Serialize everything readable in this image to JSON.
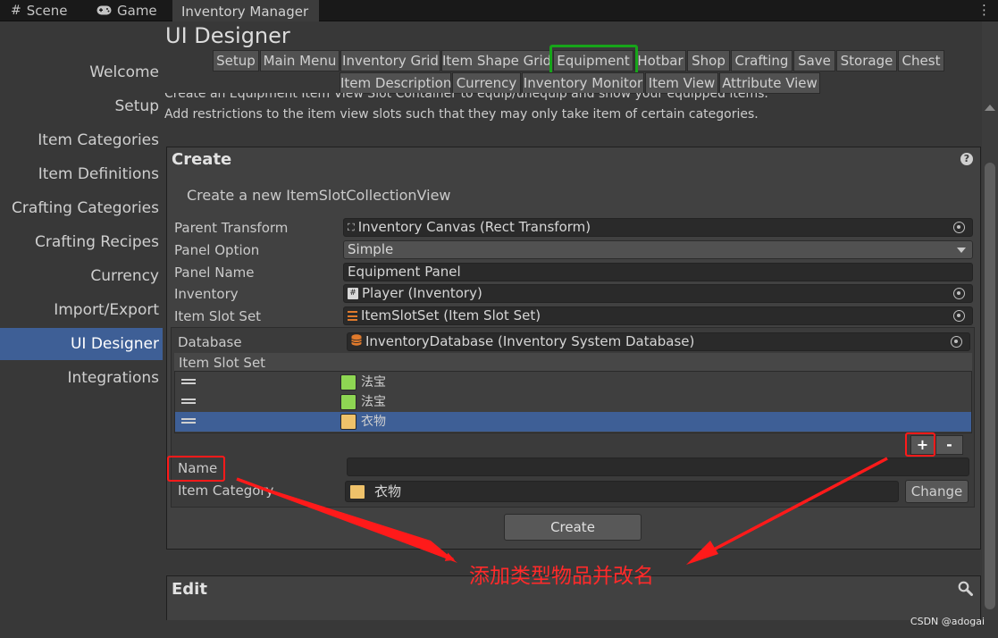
{
  "tabs": [
    {
      "label": "Scene",
      "icon": "hash-icon"
    },
    {
      "label": "Game",
      "icon": "gamepad-icon"
    },
    {
      "label": "Inventory Manager",
      "icon": ""
    }
  ],
  "sidebar": {
    "items": [
      {
        "label": "Welcome"
      },
      {
        "label": "Setup"
      },
      {
        "label": "Item Categories"
      },
      {
        "label": "Item Definitions"
      },
      {
        "label": "Crafting Categories"
      },
      {
        "label": "Crafting Recipes"
      },
      {
        "label": "Currency"
      },
      {
        "label": "Import/Export"
      },
      {
        "label": "UI Designer"
      },
      {
        "label": "Integrations"
      }
    ],
    "active": "UI Designer"
  },
  "header": {
    "title": "UI Designer",
    "nav_row1": [
      "Setup",
      "Main Menu",
      "Inventory Grid",
      "Item Shape Grid",
      "Equipment",
      "Hotbar",
      "Shop",
      "Crafting",
      "Save",
      "Storage",
      "Chest"
    ],
    "nav_row2": [
      "Item Description",
      "Currency",
      "Inventory Monitor",
      "Item View",
      "Attribute View"
    ],
    "active_nav": "Equipment",
    "description_line1": "Create an Equipment Item View Slot Container to equip/unequip and show your equipped items.",
    "description_line2": "Add restrictions to the item view slots such that they may only take item of certain categories."
  },
  "create_panel": {
    "heading": "Create",
    "subtitle": "Create a new ItemSlotCollectionView",
    "fields": {
      "parent_transform_label": "Parent Transform",
      "parent_transform_value": "Inventory Canvas (Rect Transform)",
      "panel_option_label": "Panel Option",
      "panel_option_value": "Simple",
      "panel_name_label": "Panel Name",
      "panel_name_value": "Equipment Panel",
      "inventory_label": "Inventory",
      "inventory_value": "Player (Inventory)",
      "item_slot_set_label": "Item Slot Set",
      "item_slot_set_value": "ItemSlotSet (Item Slot Set)",
      "database_label": "Database",
      "database_value": "InventoryDatabase (Inventory System Database)"
    },
    "slot_list": {
      "header": "Item Slot Set",
      "rows": [
        {
          "label": "法宝",
          "color": "#8ed653",
          "selected": false
        },
        {
          "label": "法宝",
          "color": "#8ed653",
          "selected": false
        },
        {
          "label": "衣物",
          "color": "#efc26a",
          "selected": true
        }
      ],
      "add_label": "+",
      "remove_label": "-"
    },
    "name_label": "Name",
    "name_value": "",
    "item_category_label": "Item Category",
    "item_category_value": "衣物",
    "item_category_color": "#efc26a",
    "change_label": "Change",
    "create_button": "Create"
  },
  "edit_panel": {
    "heading": "Edit"
  },
  "annotation": {
    "text": "添加类型物品并改名",
    "color": "#ff2a2a"
  },
  "watermark": "CSDN @adogai",
  "colors": {
    "selection": "#3e5f96",
    "highlight_green": "#17a51a",
    "highlight_red": "#ff1a1a"
  }
}
